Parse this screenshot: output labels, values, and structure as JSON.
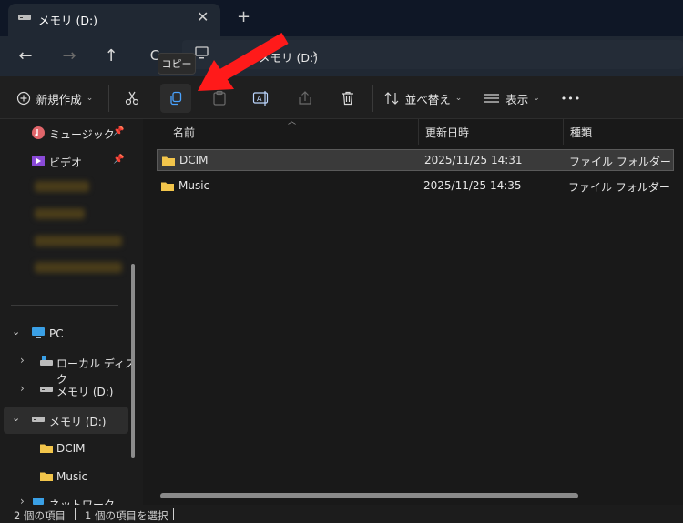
{
  "tab": {
    "title": "メモリ (D:)",
    "close": "✕",
    "new_tab": "+"
  },
  "nav": {
    "back": "←",
    "forward": "→",
    "up": "↑",
    "refresh": "C",
    "address": "メモリ (D:)",
    "chevron": "›"
  },
  "tooltip": "コピー",
  "toolbar": {
    "new_label": "新規作成",
    "sort_label": "並べ替え",
    "view_label": "表示",
    "more": "•••"
  },
  "sidebar": {
    "quick": [
      {
        "label": "ミュージック",
        "pinned": true
      },
      {
        "label": "ビデオ",
        "pinned": true
      }
    ],
    "tree": [
      {
        "label": "PC"
      },
      {
        "label": "ローカル ディスク"
      },
      {
        "label": "メモリ (D:)"
      },
      {
        "label": "メモリ (D:)"
      },
      {
        "label": "DCIM"
      },
      {
        "label": "Music"
      },
      {
        "label": "ネットワーク"
      }
    ]
  },
  "columns": {
    "name": "名前",
    "date": "更新日時",
    "type": "種類"
  },
  "files": [
    {
      "name": "DCIM",
      "date": "2025/11/25 14:31",
      "type": "ファイル フォルダー",
      "selected": true
    },
    {
      "name": "Music",
      "date": "2025/11/25 14:35",
      "type": "ファイル フォルダー",
      "selected": false
    }
  ],
  "status": {
    "count": "2 個の項目",
    "selection": "1 個の項目を選択"
  },
  "colors": {
    "accent": "#ff1a1a",
    "folder": "#f2c54b"
  }
}
